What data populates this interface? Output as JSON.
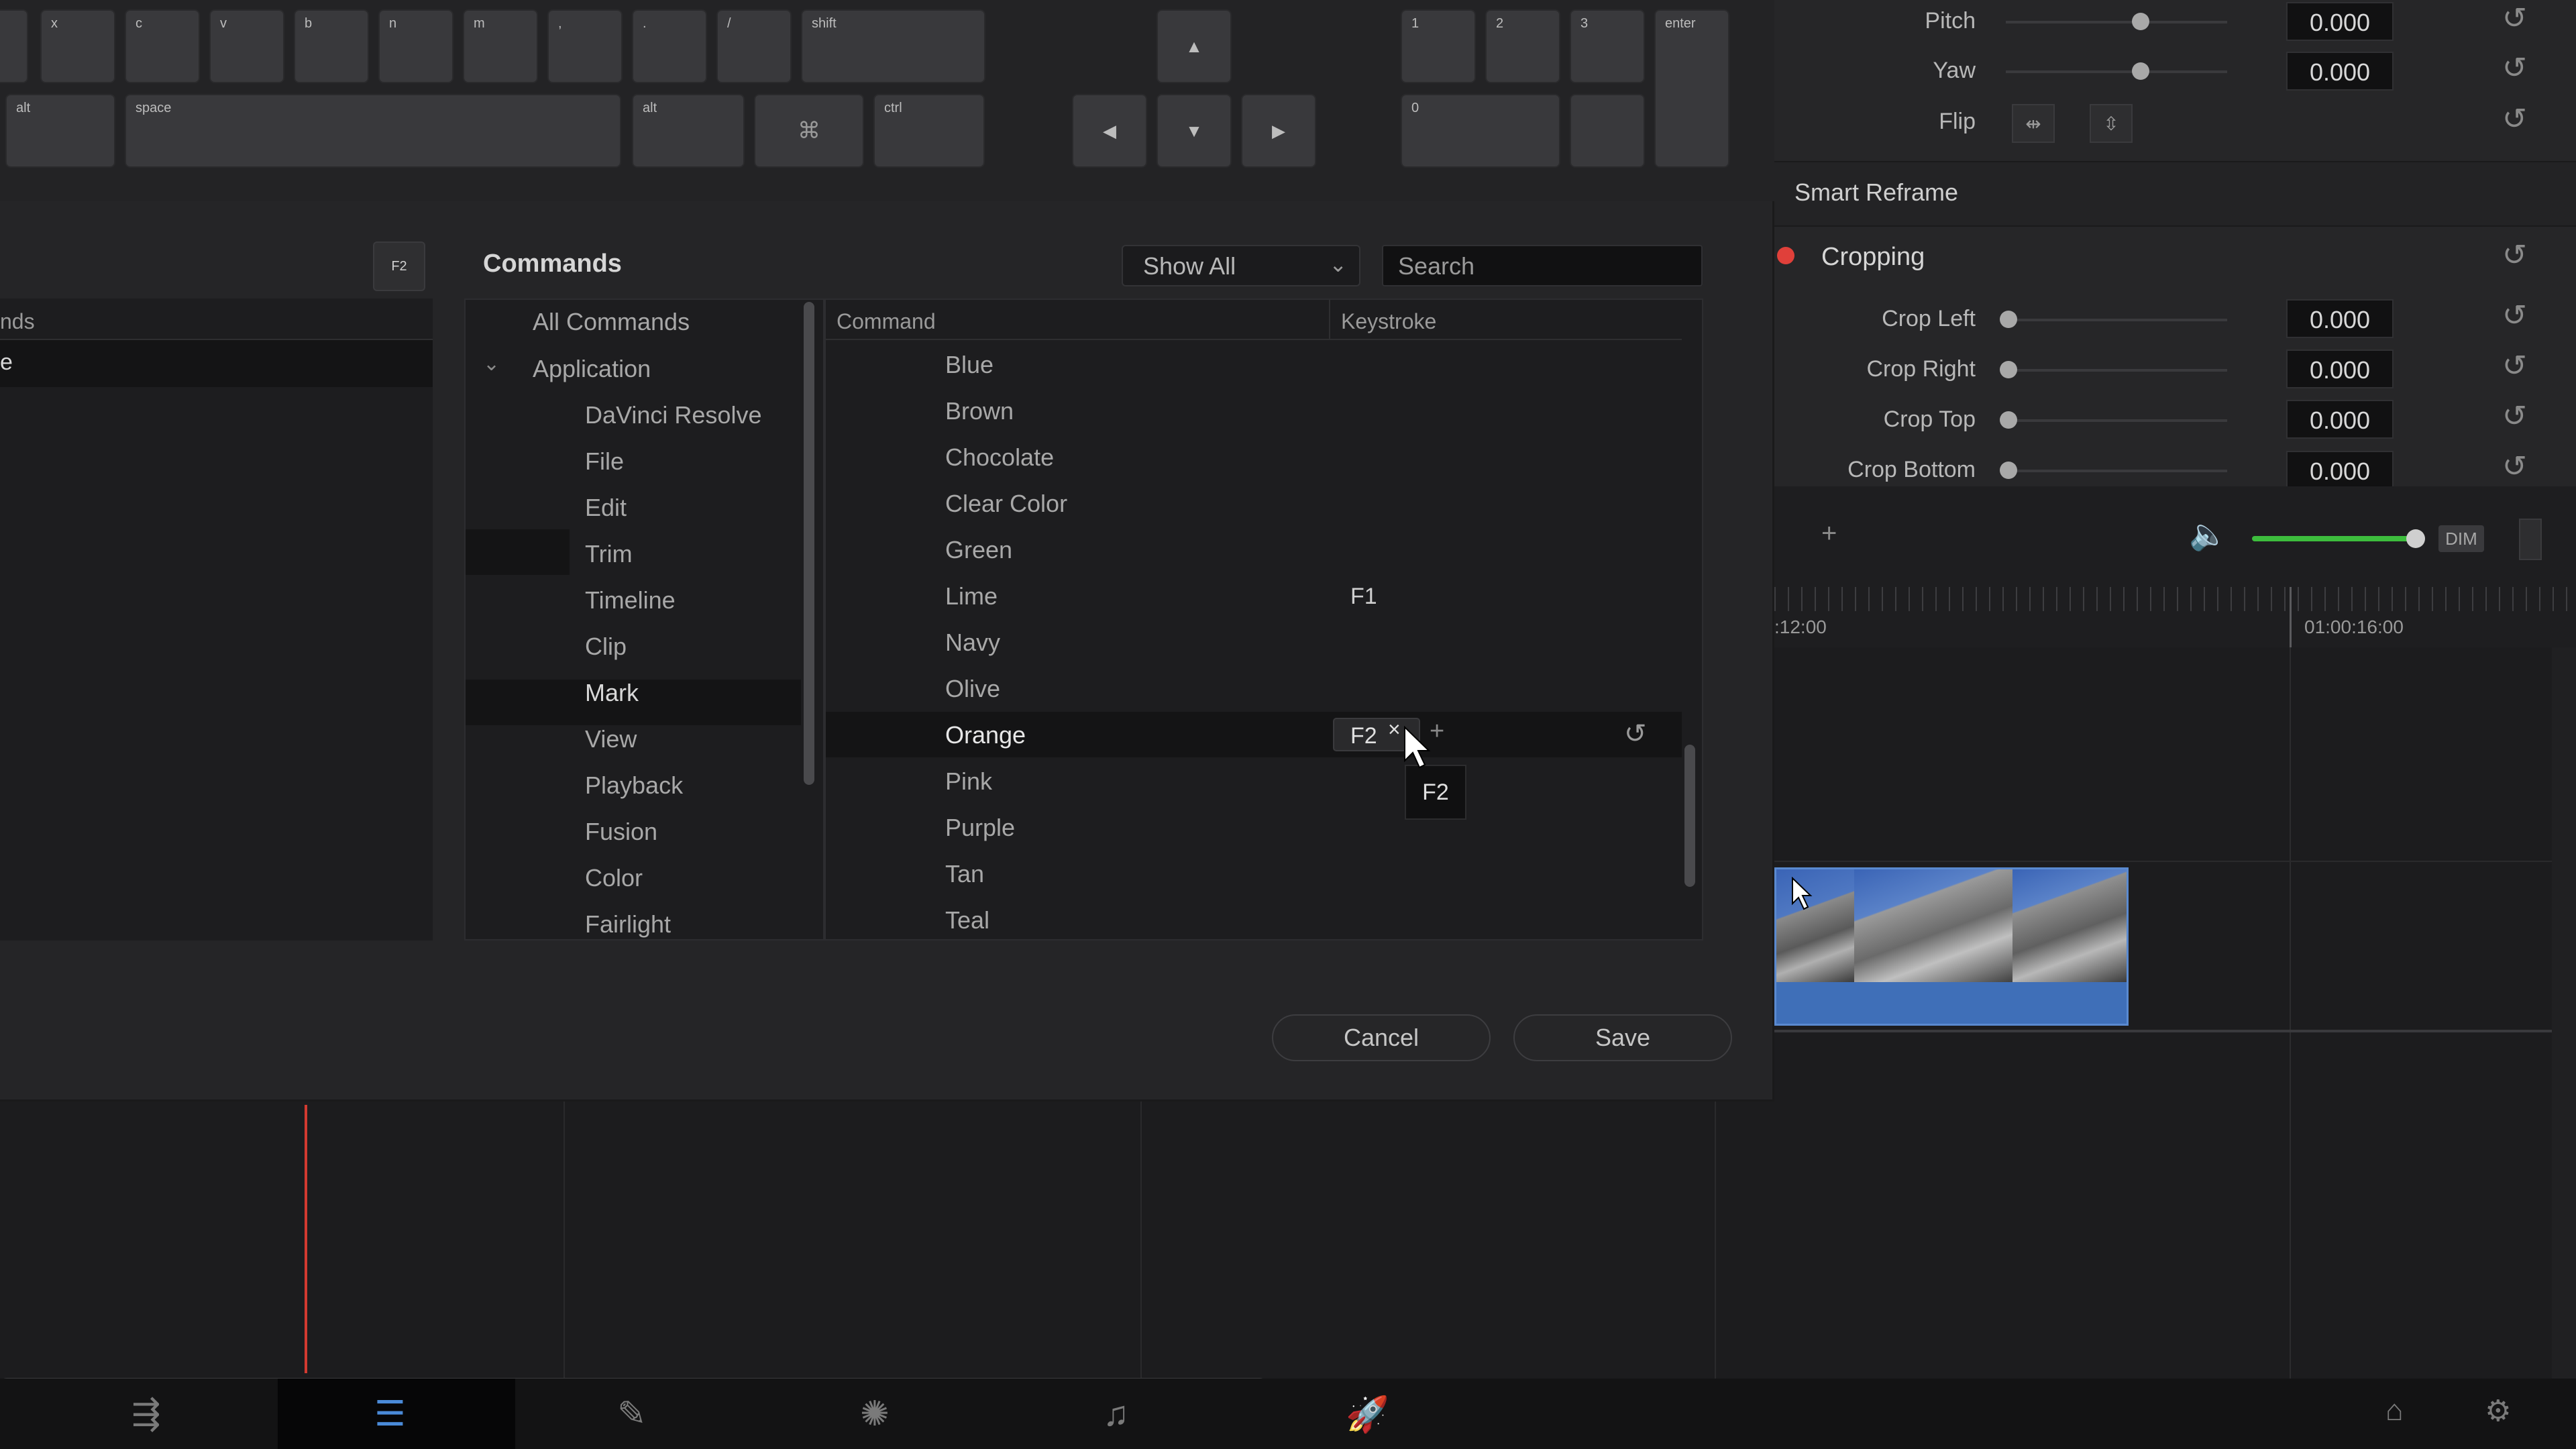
{
  "keyboard": {
    "keys": [
      "x",
      "c",
      "v",
      "b",
      "n",
      "m",
      ",",
      ".",
      "/",
      "shift",
      "alt",
      "space",
      "alt",
      "",
      "ctrl",
      "1",
      "2",
      "3",
      "enter",
      "0"
    ],
    "arrow_up": "▲",
    "arrow_left": "◀",
    "arrow_down": "▼",
    "arrow_right": "▶"
  },
  "dialog": {
    "left_header": "nds",
    "left_selected": "e",
    "f2_badge": "F2",
    "commands_title": "Commands",
    "filter": {
      "selected": "Show All"
    },
    "search": {
      "placeholder": "Search"
    },
    "categories": [
      "All Commands",
      "Application",
      "DaVinci Resolve",
      "File",
      "Edit",
      "Trim",
      "Timeline",
      "Clip",
      "Mark",
      "View",
      "Playback",
      "Fusion",
      "Color",
      "Fairlight"
    ],
    "columns": {
      "command": "Command",
      "keystroke": "Keystroke"
    },
    "rows": [
      {
        "name": "Blue",
        "keystroke": ""
      },
      {
        "name": "Brown",
        "keystroke": ""
      },
      {
        "name": "Chocolate",
        "keystroke": ""
      },
      {
        "name": "Clear Color",
        "keystroke": ""
      },
      {
        "name": "Green",
        "keystroke": ""
      },
      {
        "name": "Lime",
        "keystroke": "F1"
      },
      {
        "name": "Navy",
        "keystroke": ""
      },
      {
        "name": "Olive",
        "keystroke": ""
      },
      {
        "name": "Orange",
        "keystroke": "F2"
      },
      {
        "name": "Pink",
        "keystroke": ""
      },
      {
        "name": "Purple",
        "keystroke": ""
      },
      {
        "name": "Tan",
        "keystroke": ""
      },
      {
        "name": "Teal",
        "keystroke": ""
      }
    ],
    "tooltip": "F2",
    "cancel_label": "Cancel",
    "save_label": "Save"
  },
  "inspector": {
    "pitch": {
      "label": "Pitch",
      "value": "0.000"
    },
    "yaw": {
      "label": "Yaw",
      "value": "0.000"
    },
    "flip_label": "Flip",
    "smart_reframe": "Smart Reframe",
    "cropping": "Cropping",
    "crop_left": {
      "label": "Crop Left",
      "value": "0.000"
    },
    "crop_right": {
      "label": "Crop Right",
      "value": "0.000"
    },
    "crop_top": {
      "label": "Crop Top",
      "value": "0.000"
    },
    "crop_bottom": {
      "label": "Crop Bottom",
      "value": "0.000"
    }
  },
  "timeline": {
    "dim_label": "DIM",
    "tc_left": ":12:00",
    "tc_right": "01:00:16:00"
  },
  "colors": {
    "accent_green": "#3dbd3d",
    "cropping_dot": "#e0403a",
    "playhead": "#d23a30",
    "clip_blue": "#3f6fb8"
  }
}
